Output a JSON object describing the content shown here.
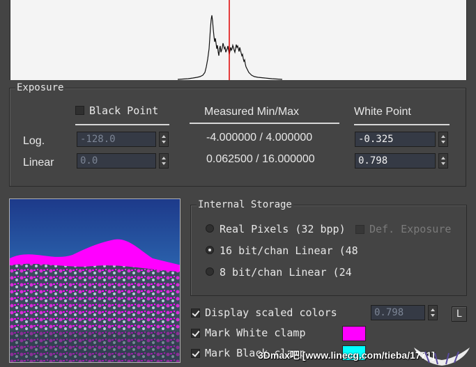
{
  "exposure": {
    "group_label": "Exposure",
    "black_point": {
      "label": "Black Point",
      "checked": false
    },
    "measured_header": "Measured Min/Max",
    "white_point_header": "White Point",
    "rows": [
      {
        "label": "Log.",
        "black": "-128.0",
        "measured": "-4.000000 / 4.000000",
        "white": "-0.325"
      },
      {
        "label": "Linear",
        "black": "0.0",
        "measured": "0.062500 / 16.000000",
        "white": "0.798"
      }
    ]
  },
  "internal_storage": {
    "group_label": "Internal Storage",
    "options": [
      {
        "label": "Real Pixels (32 bpp)",
        "selected": false
      },
      {
        "label": "16 bit/chan Linear (48",
        "selected": true
      },
      {
        "label": "8 bit/chan Linear (24",
        "selected": false
      }
    ],
    "def_exposure": {
      "label": "Def. Exposure",
      "checked": false,
      "enabled": false
    }
  },
  "display": {
    "scaled": {
      "label": "Display scaled colors",
      "checked": true,
      "value": "0.798",
      "l_button": "L"
    },
    "white_clamp": {
      "label": "Mark White clamp",
      "checked": true,
      "color": "#ff00ff"
    },
    "black_clamp": {
      "label": "Mark Black clamp",
      "checked": true,
      "color": "#00ffff"
    }
  },
  "watermark": {
    "text": "3Dmax吧 [www.linecg.com/tieba/1771]"
  },
  "colors": {
    "panel": "#444444",
    "histogram_marker": "#e00000"
  }
}
